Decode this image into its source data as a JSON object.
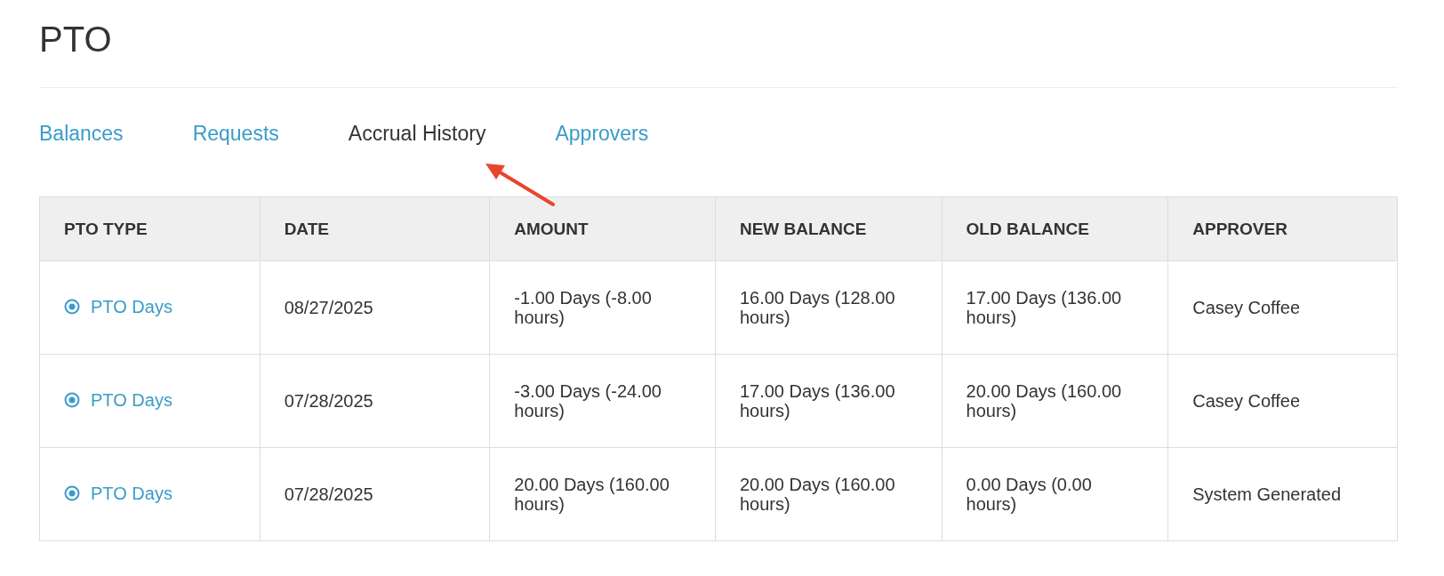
{
  "page": {
    "title": "PTO"
  },
  "tabs": [
    {
      "label": "Balances",
      "selected": false
    },
    {
      "label": "Requests",
      "selected": false
    },
    {
      "label": "Accrual History",
      "selected": true
    },
    {
      "label": "Approvers",
      "selected": false
    }
  ],
  "table": {
    "columns": [
      "PTO TYPE",
      "DATE",
      "AMOUNT",
      "NEW BALANCE",
      "OLD BALANCE",
      "APPROVER"
    ],
    "rows": [
      {
        "pto_type": "PTO Days",
        "date": "08/27/2025",
        "amount": "-1.00 Days (-8.00 hours)",
        "new_balance": "16.00 Days (128.00 hours)",
        "old_balance": "17.00 Days (136.00 hours)",
        "approver": "Casey Coffee"
      },
      {
        "pto_type": "PTO Days",
        "date": "07/28/2025",
        "amount": "-3.00 Days (-24.00 hours)",
        "new_balance": "17.00 Days (136.00 hours)",
        "old_balance": "20.00 Days (160.00 hours)",
        "approver": "Casey Coffee"
      },
      {
        "pto_type": "PTO Days",
        "date": "07/28/2025",
        "amount": "20.00 Days (160.00 hours)",
        "new_balance": "20.00 Days (160.00 hours)",
        "old_balance": "0.00 Days (0.00 hours)",
        "approver": "System Generated"
      }
    ]
  }
}
